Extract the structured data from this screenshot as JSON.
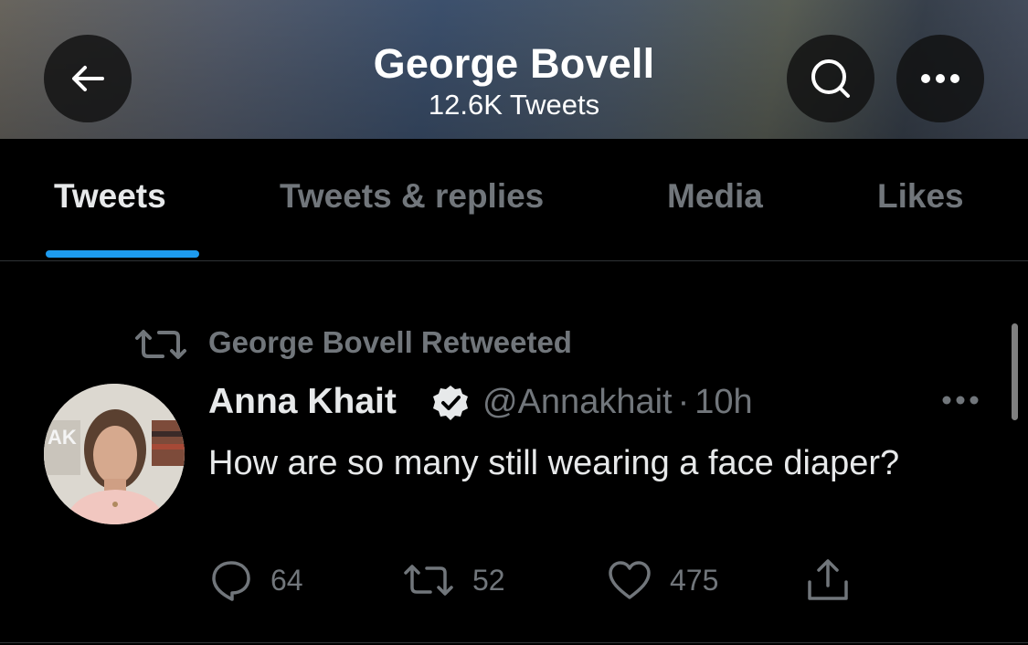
{
  "header": {
    "title": "George Bovell",
    "subtitle": "12.6K Tweets",
    "back_icon": "arrow-left-icon",
    "search_icon": "search-icon",
    "more_icon": "more-horizontal-icon"
  },
  "tabs": [
    {
      "label": "Tweets",
      "active": true
    },
    {
      "label": "Tweets & replies",
      "active": false
    },
    {
      "label": "Media",
      "active": false
    },
    {
      "label": "Likes",
      "active": false
    }
  ],
  "tweet": {
    "retweet_context": "George Bovell Retweeted",
    "author_name": "Anna Khait",
    "verified": true,
    "handle": "@Annakhait",
    "time": "10h",
    "meta_separator": "·",
    "text": "How are so many still wearing a face diaper?",
    "actions": {
      "replies": "64",
      "retweets": "52",
      "likes": "475"
    }
  },
  "colors": {
    "accent": "#1d9bf0",
    "background": "#000000",
    "secondary_text": "#71767b",
    "primary_text": "#e7e9ea"
  }
}
